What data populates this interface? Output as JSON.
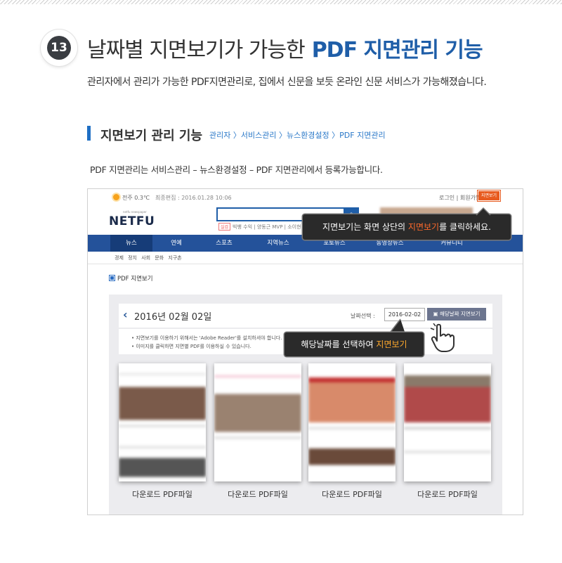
{
  "badge_number": "13",
  "title": {
    "part1": "날짜별 지면보기가 가능한",
    "highlight": "PDF 지면관리 기능"
  },
  "description": "관리자에서 관리가 가능한 PDF지면관리로, 집에서 신문을 보듯 온라인 신문 서비스가 가능해졌습니다.",
  "section": {
    "title": "지면보기 관리 기능",
    "path": "관리자 〉서비스관리 〉뉴스환경설정 〉PDF 지면관리",
    "desc": "PDF 지면관리는 서비스관리 – 뉴스환경설정 – PDF 지면관리에서 등록가능합니다."
  },
  "site": {
    "weather": "전주 0.3℃",
    "updated": "최종편집 : 2016.01.28 10:06",
    "top_links": "로그인 | 회원가입",
    "pdf_button": "지면보기",
    "logo": "NETFU",
    "logo_sub": "netfu newspaper",
    "search_icon": "search-icon",
    "hot_keyword_tag": "실검",
    "hot_keywords": "빅뱅 수익 | 양동근 MVP | 소이현 인교진",
    "nav": [
      "뉴스",
      "연예",
      "스포츠",
      "지역뉴스",
      "포토뉴스",
      "동영상뉴스",
      "커뮤니티"
    ],
    "subnav": "경제 정치 사회 문화 지구촌",
    "pdf_section_label": "PDF 지면보기",
    "date_heading": "2016년 02월 02일",
    "date_select_label": "날짜선택 :",
    "date_value": "2016-02-02",
    "date_button": "해당날짜 지면보기",
    "notes": [
      "• 지면보기를 이용하기 위해서는 'Adobe Reader'를 설치하셔야 합니다.",
      "• 이미지를 클릭하면 지면별 PDF를 이용하실 수 있습니다."
    ],
    "download_label": "다운로드 PDF파일",
    "thumbnails": [
      {
        "accent": "#c0392b"
      },
      {
        "accent": "#d24a7a"
      },
      {
        "accent": "#c23030"
      },
      {
        "accent": "#8a3a3a"
      }
    ]
  },
  "tooltip1": {
    "before": "지면보기는 화면 상단의 ",
    "highlight": "지면보기",
    "after": "를 클릭하세요."
  },
  "tooltip2": {
    "before": "해당날짜를 선택하여 ",
    "highlight": "지면보기"
  },
  "colors": {
    "brand_blue": "#1f5ea8",
    "nav_blue": "#24529a",
    "highlight_orange": "#ffa92c"
  }
}
